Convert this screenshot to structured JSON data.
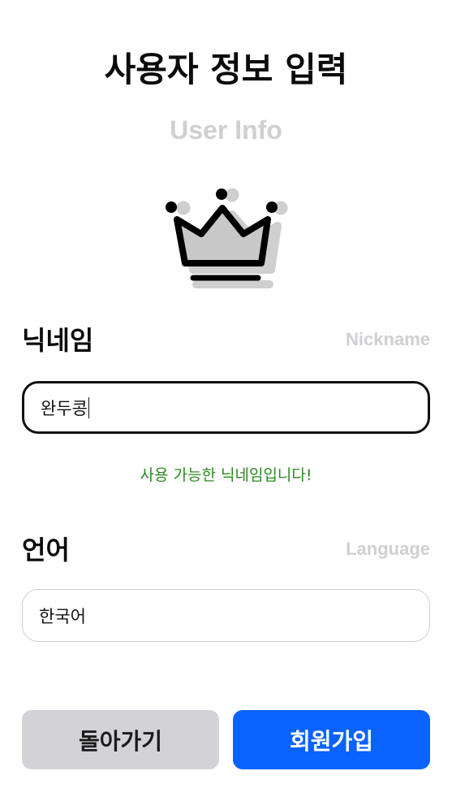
{
  "header": {
    "title": "사용자 정보 입력",
    "subtitle": "User Info"
  },
  "icons": {
    "crown": "crown-icon"
  },
  "nickname": {
    "label": "닉네임",
    "label_en": "Nickname",
    "value": "완두콩",
    "status": "사용 가능한 닉네임입니다!"
  },
  "language": {
    "label": "언어",
    "label_en": "Language",
    "value": "한국어"
  },
  "buttons": {
    "back": "돌아가기",
    "signup": "회원가입"
  },
  "colors": {
    "primary": "#0A63FF",
    "secondary": "#D2D2D7",
    "success": "#2B8A1F",
    "muted": "#CFCFD4"
  }
}
